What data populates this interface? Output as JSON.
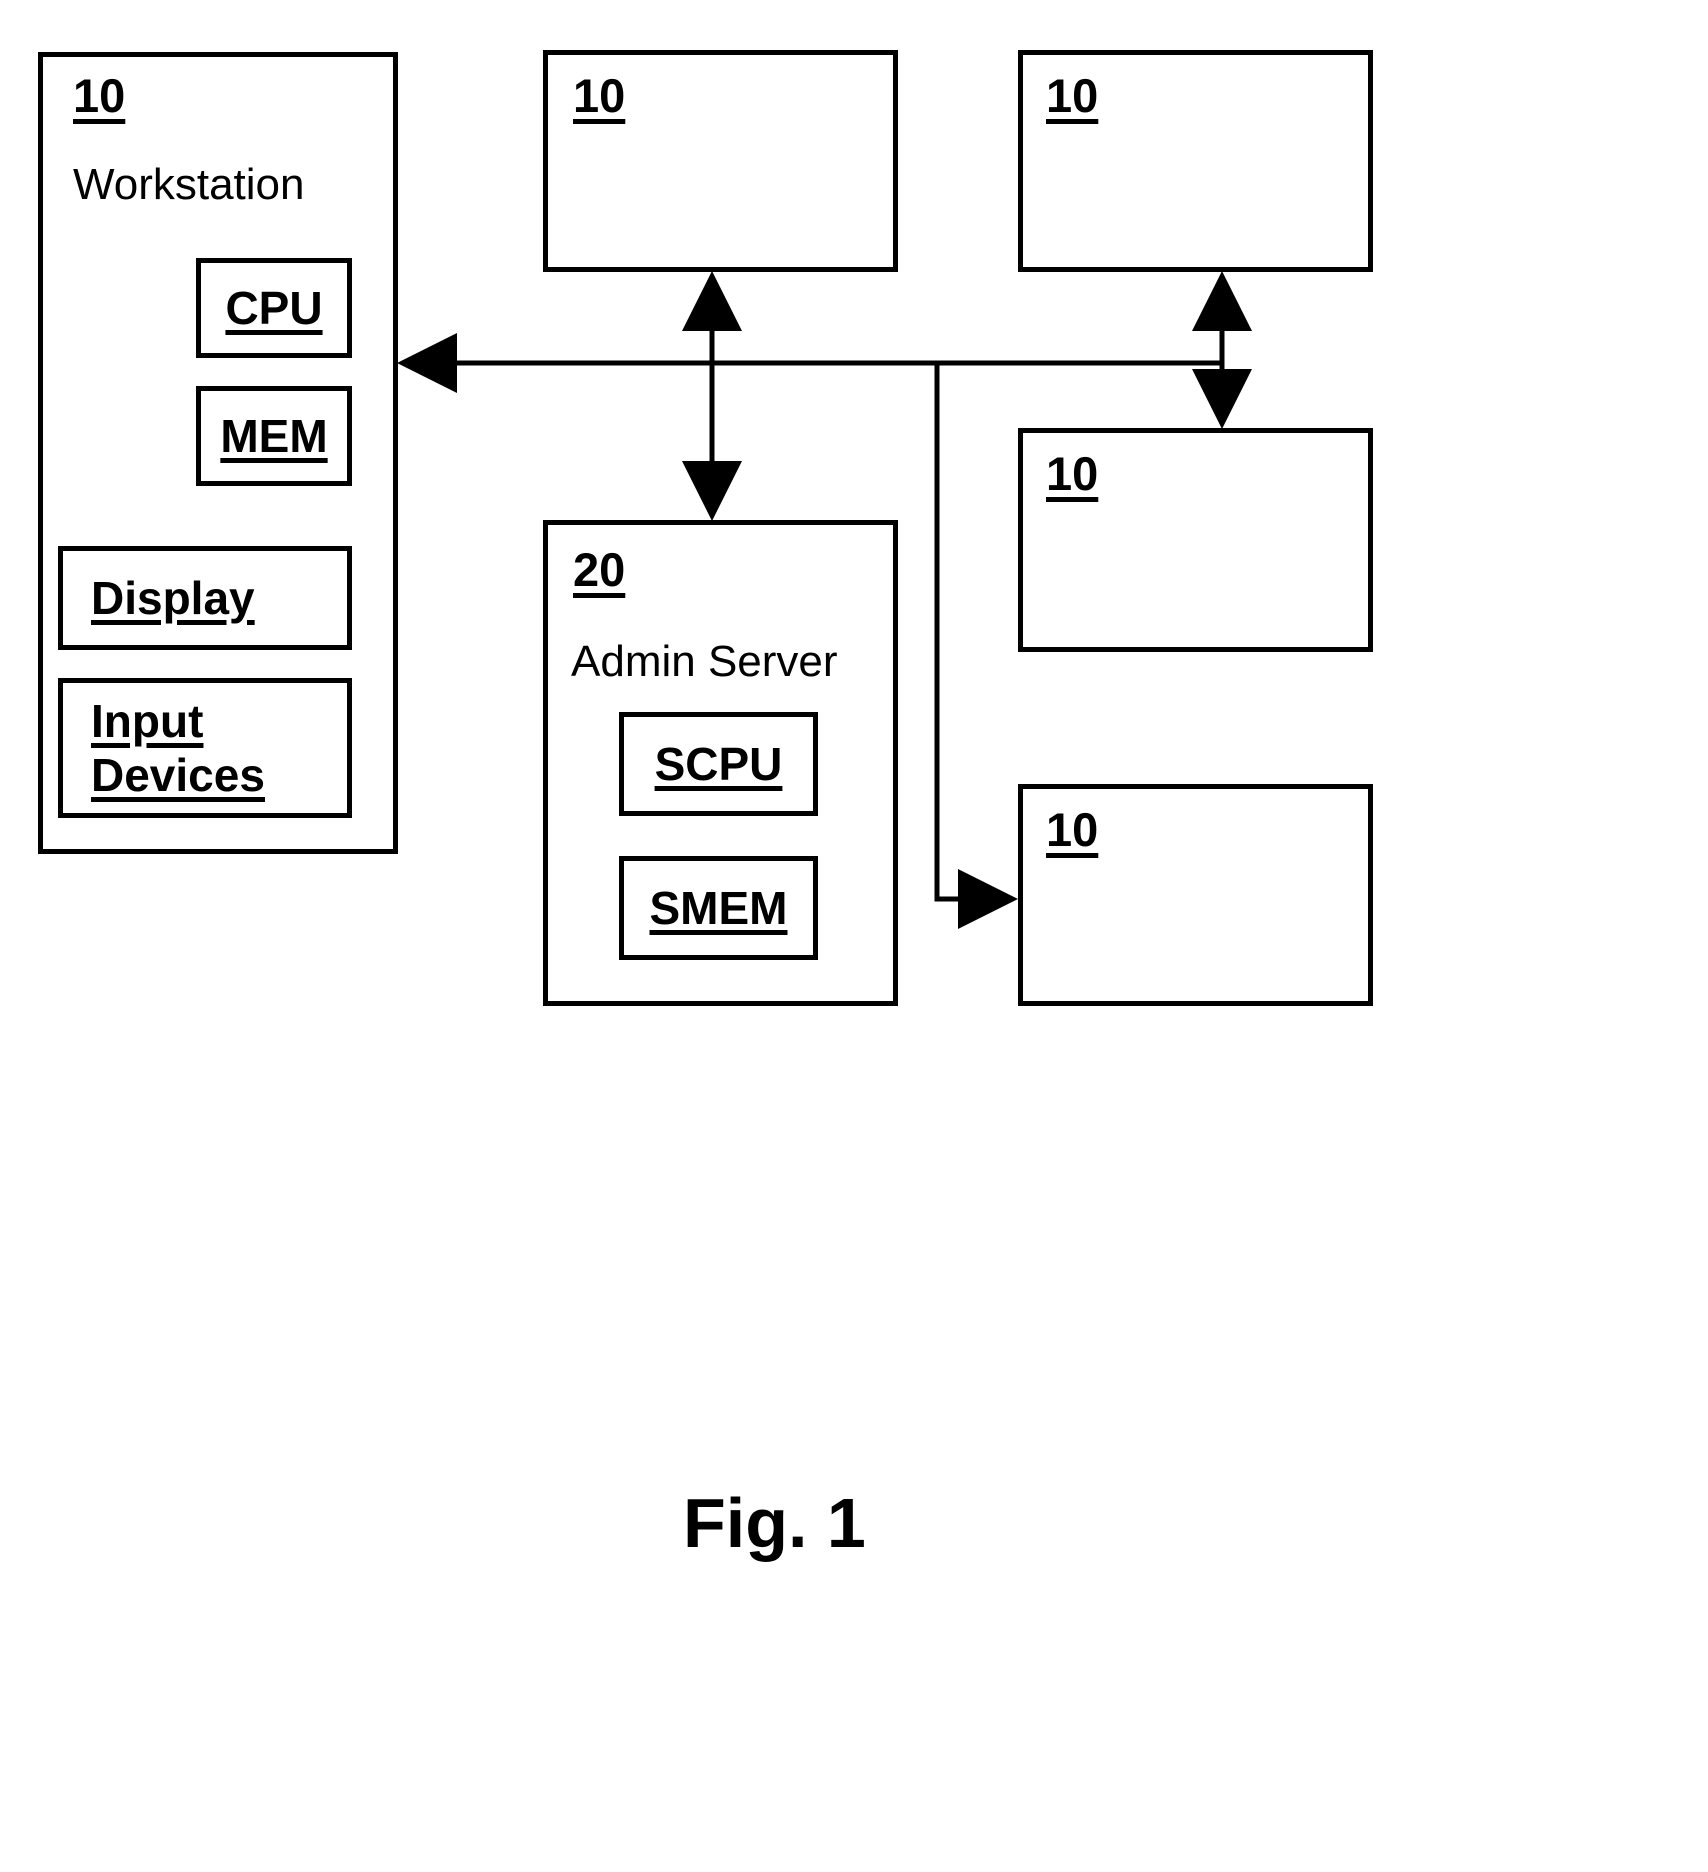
{
  "figure": {
    "caption": "Fig. 1"
  },
  "nodes": {
    "workstation": {
      "ref": "10",
      "title": "Workstation",
      "components": {
        "cpu": "CPU",
        "mem": "MEM",
        "display": "Display",
        "input_devices_line1": "Input",
        "input_devices_line2": "Devices"
      }
    },
    "admin_server": {
      "ref": "20",
      "title": "Admin Server",
      "components": {
        "scpu": "SCPU",
        "smem": "SMEM"
      }
    },
    "client_top_middle": {
      "ref": "10"
    },
    "client_top_right": {
      "ref": "10"
    },
    "client_mid_right": {
      "ref": "10"
    },
    "client_bottom_right": {
      "ref": "10"
    }
  },
  "style": {
    "stroke": "#000000",
    "background": "#ffffff"
  }
}
